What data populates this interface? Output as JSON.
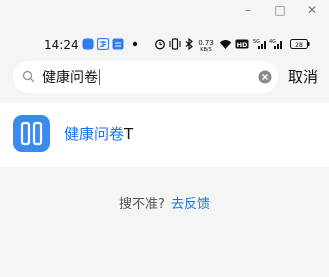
{
  "window": {
    "minimize": "–",
    "maximize": "□",
    "close": "✕"
  },
  "status_bar": {
    "time": "14:24",
    "speed_value": "0.73",
    "speed_unit": "KB/S",
    "battery": "28",
    "icons": [
      "app-notification-icon",
      "alipay-icon",
      "alipay-box-icon",
      "dot-icon",
      "alarm-icon",
      "vibrate-icon",
      "bluetooth-icon",
      "wifi-icon",
      "hd-icon",
      "signal-5g-icon",
      "signal-4g-icon",
      "battery-icon"
    ]
  },
  "search": {
    "query_highlight": "健康问卷",
    "cancel_label": "取消"
  },
  "results": [
    {
      "title_highlight": "健康问卷",
      "title_rest": "T",
      "icon": "health-survey-app-icon"
    }
  ],
  "feedback": {
    "question": "搜不准?",
    "link": "去反馈"
  },
  "colors": {
    "accent": "#1a73e8",
    "app_icon": "#3a8bf0",
    "background": "#f5f5f5"
  }
}
